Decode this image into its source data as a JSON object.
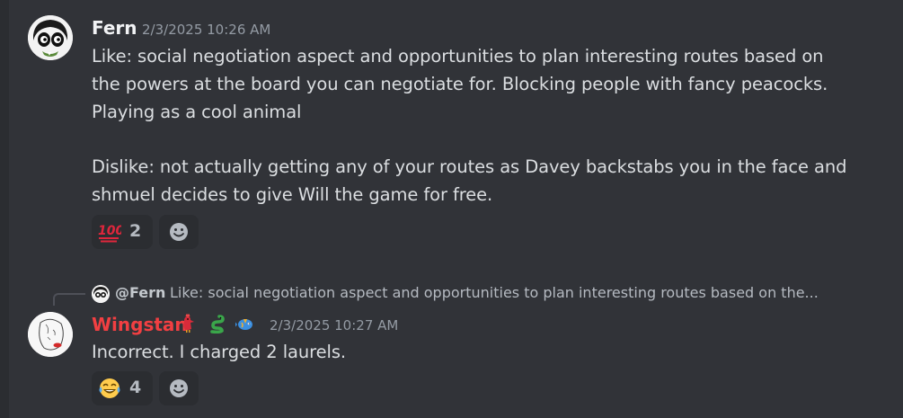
{
  "messages": [
    {
      "author": "Fern",
      "timestamp": "2/3/2025 10:26 AM",
      "lines": [
        "Like: social negotiation aspect and opportunities to plan interesting routes based on",
        "the powers at the board you can negotiate for. Blocking people with fancy peacocks.",
        "Playing as a cool animal",
        "Dislike: not actually getting any of your routes as Davey backstabs you in the face and",
        "shmuel decides to give Will the game for free."
      ],
      "reactions": [
        {
          "emoji": "hundred-points-emoji",
          "count": "2"
        }
      ]
    },
    {
      "author": "Wingstan",
      "author_color": "#f23f42",
      "timestamp": "2/3/2025 10:27 AM",
      "badges": [
        "rooster-icon",
        "snake-icon",
        "fish-icon"
      ],
      "reply": {
        "name": "@Fern",
        "text": "Like: social negotiation aspect and opportunities to plan interesting routes based on the..."
      },
      "lines": [
        "Incorrect. I charged 2 laurels."
      ],
      "reactions": [
        {
          "emoji": "tears-of-joy-emoji",
          "count": "4"
        }
      ]
    }
  ]
}
